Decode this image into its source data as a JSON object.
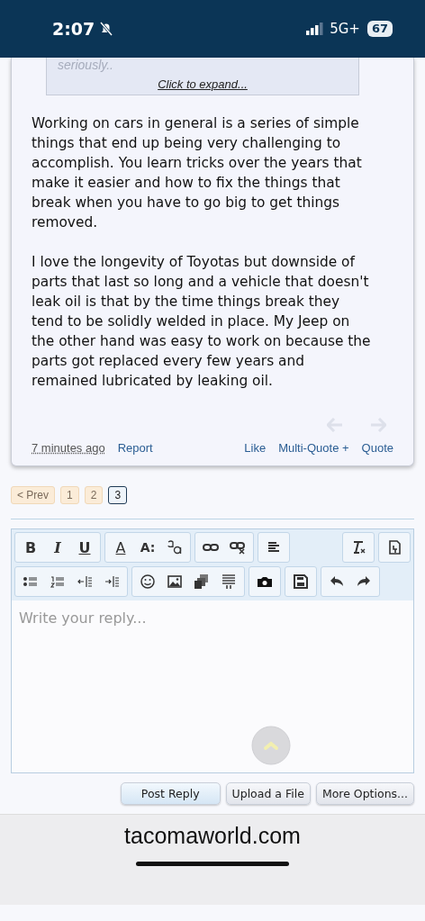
{
  "status_bar": {
    "time": "2:07",
    "network": "5G+",
    "battery": "67"
  },
  "post": {
    "quote": {
      "text": "seriously..",
      "expand": "Click to expand..."
    },
    "paragraphs": [
      "Working on cars in general is a series of simple things that end up being very challenging to accomplish. You learn tricks over the years that make it easier and how to fix the things that break when you have to go big to get things removed.",
      "I love the longevity of Toyotas but downside of parts that last so long and a vehicle that doesn't leak oil is that by the time things break they tend to be solidly welded in place. My Jeep on the other hand was easy to work on because the parts got replaced every few years and remained lubricated by leaking oil."
    ],
    "time": "7 minutes ago",
    "links_left": [
      "Report"
    ],
    "links_right": [
      "Like",
      "Multi-Quote +",
      "Quote"
    ]
  },
  "pagination": {
    "prev": "< Prev",
    "pages": [
      {
        "label": "1",
        "selected": false
      },
      {
        "label": "2",
        "selected": false
      },
      {
        "label": "3",
        "selected": true
      }
    ]
  },
  "editor": {
    "toolbar_rows": [
      {
        "groups": [
          [
            {
              "kind": "bold",
              "label": "B"
            },
            {
              "kind": "italic",
              "label": "I"
            },
            {
              "kind": "underline",
              "label": "U"
            }
          ],
          [
            {
              "kind": "color",
              "label": "A"
            },
            {
              "kind": "size",
              "label": "A:"
            },
            {
              "kind": "font"
            }
          ],
          [
            {
              "kind": "link"
            },
            {
              "kind": "unlink"
            }
          ],
          [
            {
              "kind": "align"
            }
          ]
        ],
        "right": [
          [
            {
              "kind": "clear"
            }
          ],
          [
            {
              "kind": "paste"
            }
          ]
        ]
      },
      {
        "groups": [
          [
            {
              "kind": "bullets"
            },
            {
              "kind": "numbers"
            },
            {
              "kind": "outdent"
            },
            {
              "kind": "indent"
            }
          ],
          [
            {
              "kind": "smiley"
            },
            {
              "kind": "image"
            },
            {
              "kind": "media"
            },
            {
              "kind": "code"
            }
          ],
          [
            {
              "kind": "camera"
            }
          ],
          [
            {
              "kind": "save"
            }
          ],
          [
            {
              "kind": "undo"
            },
            {
              "kind": "redo"
            }
          ]
        ],
        "right": []
      }
    ],
    "placeholder": "Write your reply...",
    "buttons": [
      {
        "label": "Post Reply",
        "kind": "primary"
      },
      {
        "label": "Upload a File",
        "kind": "normal"
      },
      {
        "label": "More Options...",
        "kind": "normal"
      }
    ]
  },
  "address_bar": {
    "domain": "tacomaworld.com"
  }
}
